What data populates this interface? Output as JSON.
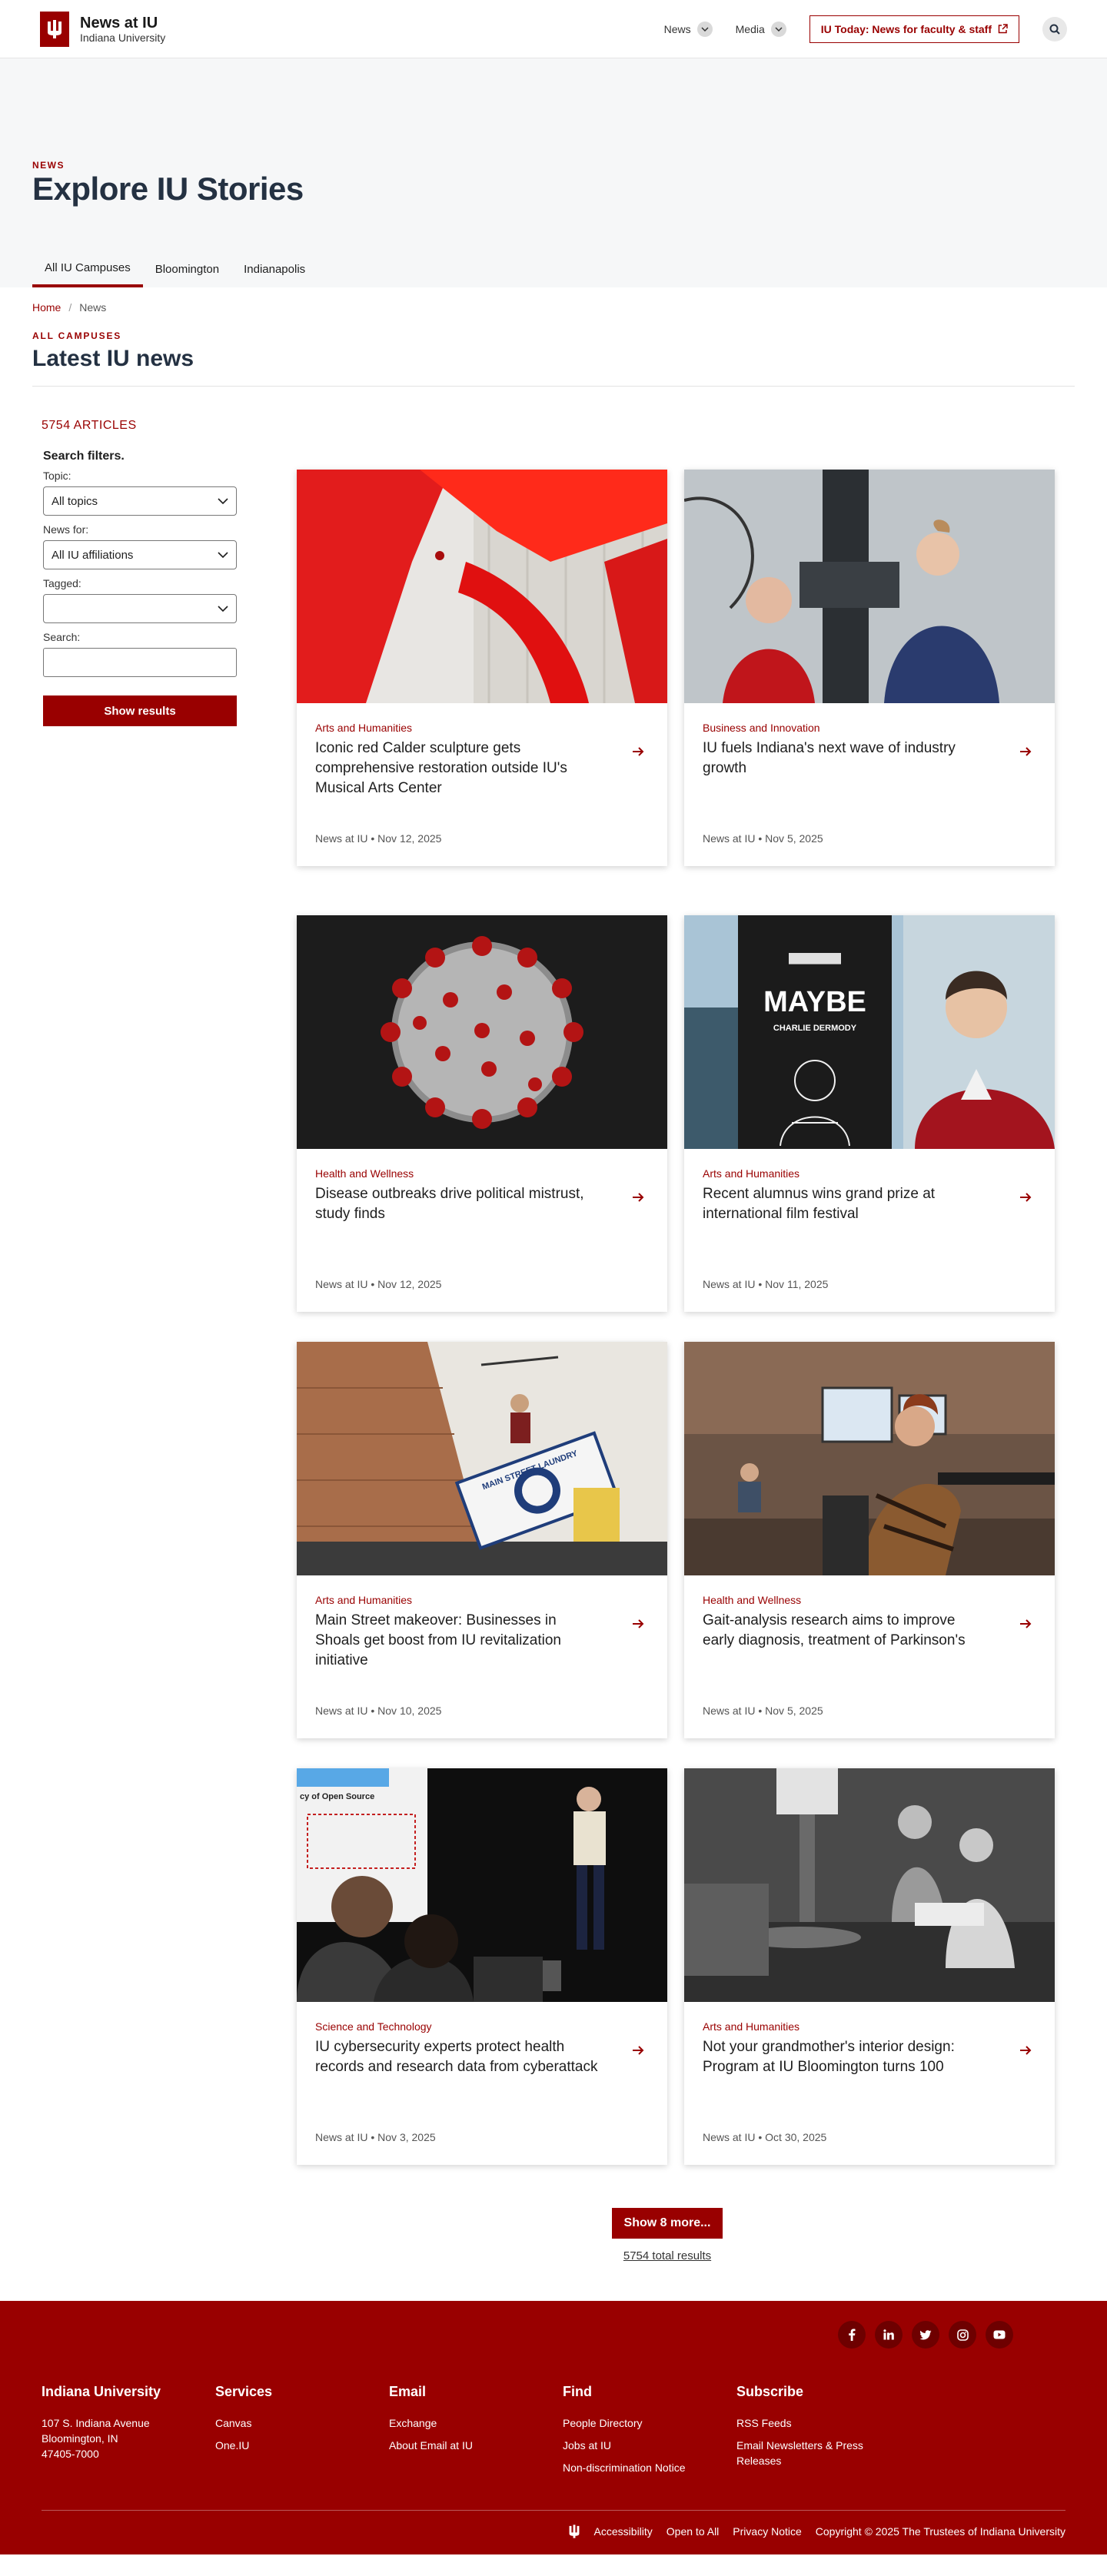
{
  "header": {
    "site_title": "News at IU",
    "site_subtitle": "Indiana University",
    "nav": [
      {
        "label": "News"
      },
      {
        "label": "Media"
      }
    ],
    "iu_today": "IU Today: News for faculty & staff"
  },
  "hero": {
    "eyebrow": "NEWS",
    "title": "Explore IU Stories",
    "tabs": [
      "All IU Campuses",
      "Bloomington",
      "Indianapolis"
    ]
  },
  "breadcrumb": {
    "home": "Home",
    "sep": "/",
    "current": "News"
  },
  "section": {
    "eyebrow": "ALL CAMPUSES",
    "title": "Latest IU news"
  },
  "filters": {
    "count": "5754 ARTICLES",
    "title": "Search filters.",
    "topic_label": "Topic:",
    "topic_value": "All topics",
    "newsfor_label": "News for:",
    "newsfor_value": "All IU affiliations",
    "tagged_label": "Tagged:",
    "tagged_value": "",
    "search_label": "Search:",
    "search_value": "",
    "button": "Show results"
  },
  "cards": [
    {
      "category": "Arts and Humanities",
      "title": "Iconic red Calder sculpture gets comprehensive restoration outside IU's Musical Arts Center",
      "source": "News at IU",
      "date": "Nov 12, 2025",
      "image": "red-sculpture"
    },
    {
      "category": "Business and Innovation",
      "title": "IU fuels Indiana's next wave of industry growth",
      "source": "News at IU",
      "date": "Nov 5, 2025",
      "image": "lab-machine"
    },
    {
      "category": "Health and Wellness",
      "title": "Disease outbreaks drive political mistrust, study finds",
      "source": "News at IU",
      "date": "Nov 12, 2025",
      "image": "virus"
    },
    {
      "category": "Arts and Humanities",
      "title": "Recent alumnus wins grand prize at international film festival",
      "source": "News at IU",
      "date": "Nov 11, 2025",
      "image": "film-poster"
    },
    {
      "category": "Arts and Humanities",
      "title": "Main Street makeover: Businesses in Shoals get boost from IU revitalization initiative",
      "source": "News at IU",
      "date": "Nov 10, 2025",
      "image": "main-street-sign"
    },
    {
      "category": "Health and Wellness",
      "title": "Gait-analysis research aims to improve early diagnosis, treatment of Parkinson's",
      "source": "News at IU",
      "date": "Nov 5, 2025",
      "image": "gait-lab"
    },
    {
      "category": "Science and Technology",
      "title": "IU cybersecurity experts protect health records and research data from cyberattack",
      "source": "News at IU",
      "date": "Nov 3, 2025",
      "image": "presentation"
    },
    {
      "category": "Arts and Humanities",
      "title": "Not your grandmother's interior design: Program at IU Bloomington turns 100",
      "source": "News at IU",
      "date": "Oct 30, 2025",
      "image": "vintage-photo"
    }
  ],
  "card_meta_sep": "•",
  "poster": {
    "title": "MAYBE",
    "subtitle": "CHARLIE DERMODY"
  },
  "sign": {
    "text": "MAIN STREET LAUNDRY"
  },
  "slide": {
    "text": "cy of Open Source"
  },
  "pagination": {
    "more": "Show 8 more...",
    "total": "5754 total results"
  },
  "footer": {
    "columns": [
      {
        "heading": "Indiana University",
        "lines": [
          "107 S. Indiana Avenue",
          "Bloomington, IN",
          "47405-7000"
        ]
      },
      {
        "heading": "Services",
        "links": [
          "Canvas",
          "One.IU"
        ]
      },
      {
        "heading": "Email",
        "links": [
          "Exchange",
          "About Email at IU"
        ]
      },
      {
        "heading": "Find",
        "links": [
          "People Directory",
          "Jobs at IU",
          "Non-discrimination Notice"
        ]
      },
      {
        "heading": "Subscribe",
        "links": [
          "RSS Feeds",
          "Email Newsletters & Press Releases"
        ]
      }
    ],
    "bottom_links": [
      "Accessibility",
      "Open to All",
      "Privacy Notice"
    ],
    "copyright": "Copyright © 2025 The Trustees of Indiana University",
    "socials": [
      "facebook-icon",
      "linkedin-icon",
      "twitter-icon",
      "instagram-icon",
      "youtube-icon"
    ]
  },
  "colors": {
    "brand": "#990000",
    "heading": "#243142",
    "hero_bg": "#f6f7f8"
  }
}
